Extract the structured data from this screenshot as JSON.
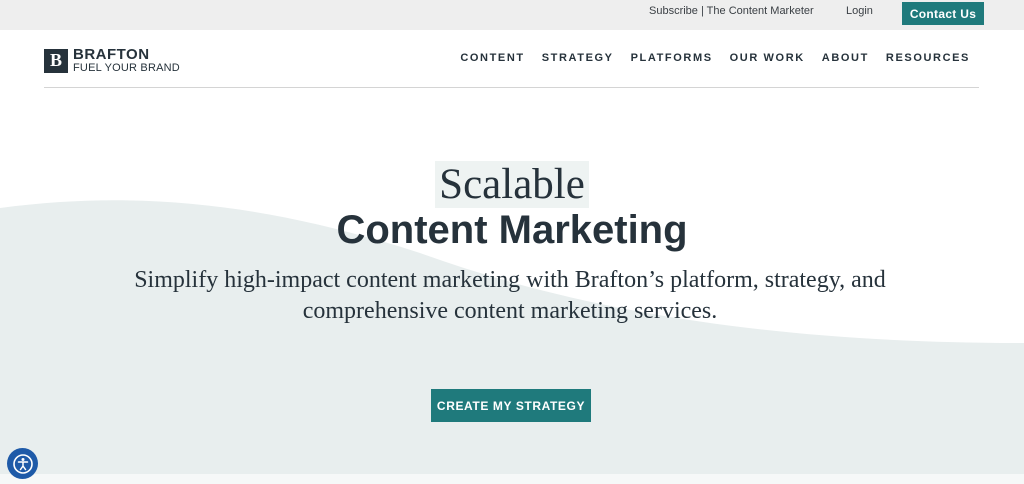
{
  "topbar": {
    "subscribe_label": "Subscribe | The Content Marketer",
    "login_label": "Login",
    "contact_label": "Contact Us"
  },
  "logo": {
    "mark": "B",
    "name": "BRAFTON",
    "tagline": "FUEL YOUR BRAND"
  },
  "nav": {
    "items": [
      {
        "label": "CONTENT"
      },
      {
        "label": "STRATEGY"
      },
      {
        "label": "PLATFORMS"
      },
      {
        "label": "OUR WORK"
      },
      {
        "label": "ABOUT"
      },
      {
        "label": "RESOURCES"
      }
    ]
  },
  "hero": {
    "title_line1": "Scalable",
    "title_line2": "Content Marketing",
    "subtitle": "Simplify high-impact content marketing with Brafton’s platform, strategy, and comprehensive content marketing services.",
    "cta_label": "CREATE MY STRATEGY"
  },
  "accessibility": {
    "icon": "accessibility-icon"
  },
  "colors": {
    "accent": "#1f7a7c",
    "text": "#26323b",
    "wave": "#e8eeee",
    "topbar": "#eeeeee",
    "a11y": "#1e5aa8"
  }
}
